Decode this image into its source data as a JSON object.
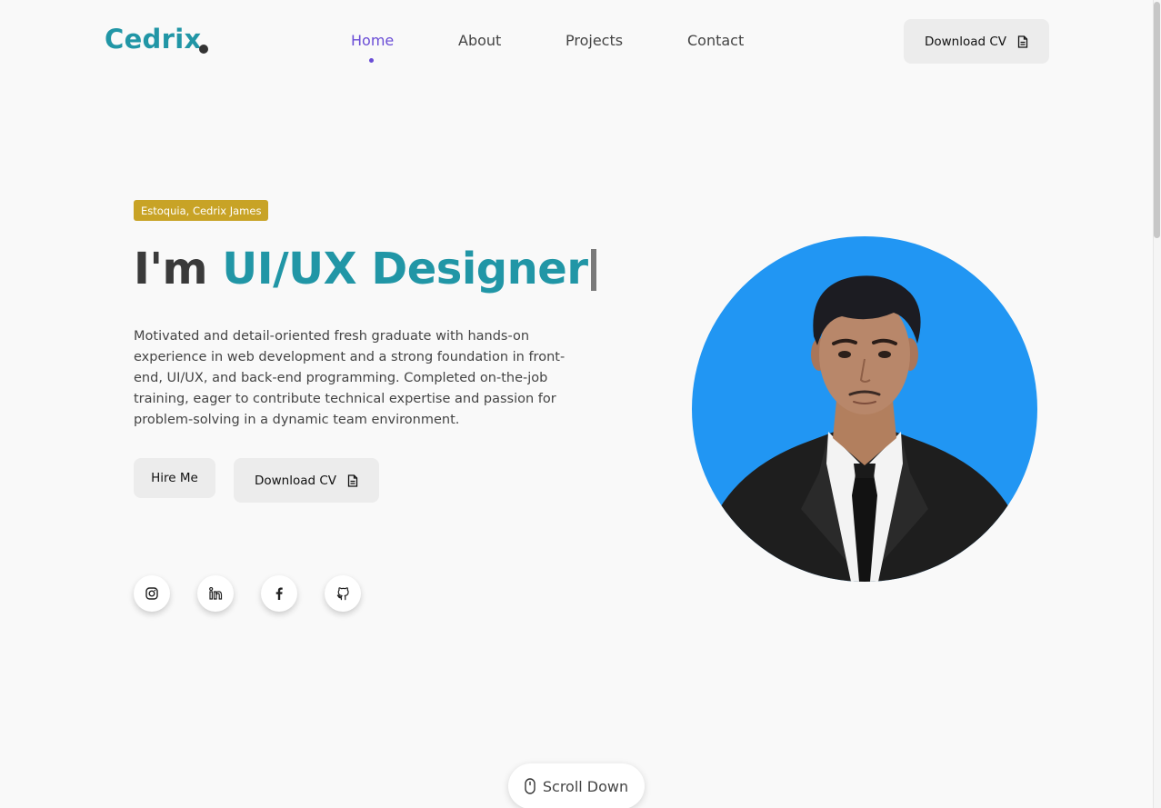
{
  "header": {
    "logo": "Cedrix",
    "nav": [
      {
        "label": "Home"
      },
      {
        "label": "About"
      },
      {
        "label": "Projects"
      },
      {
        "label": "Contact"
      }
    ],
    "cv_button": "Download CV"
  },
  "hero": {
    "name_tag": "Estoquia, Cedrix James",
    "title_prefix": "I'm ",
    "title_role": "UI/UX Designer",
    "description": "Motivated and detail-oriented fresh graduate with hands-on experience in web development and a strong foundation in front-end, UI/UX, and back-end programming. Completed on-the-job training, eager to contribute technical expertise and passion for problem-solving in a dynamic team environment.",
    "hire_button": "Hire Me",
    "cv_button": "Download CV"
  },
  "socials": [
    {
      "icon": "instagram-icon"
    },
    {
      "icon": "linkedin-icon"
    },
    {
      "icon": "facebook-icon"
    },
    {
      "icon": "github-icon"
    }
  ],
  "scroll": {
    "label": "Scroll Down"
  },
  "colors": {
    "brand": "#2196a6",
    "nav_active": "#6a4dd6",
    "tag_bg": "#c8a326",
    "photo_bg": "#2196f3",
    "page_bg": "#f9f9f9"
  }
}
